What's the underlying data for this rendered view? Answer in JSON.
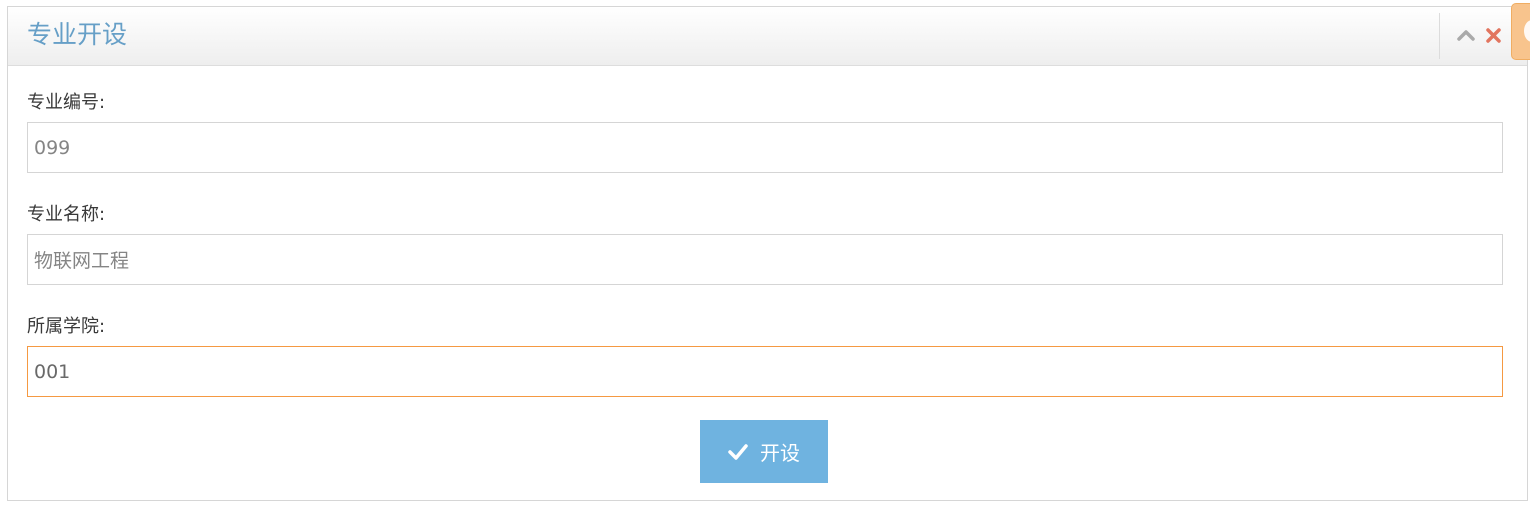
{
  "panel": {
    "title": "专业开设",
    "collapse_icon": "chevron-up-icon",
    "close_icon": "close-icon",
    "settings_icon": "gear-icon"
  },
  "form": {
    "major_code": {
      "label": "专业编号:",
      "value": "099"
    },
    "major_name": {
      "label": "专业名称:",
      "value": "物联网工程"
    },
    "college": {
      "label": "所属学院:",
      "value": "001"
    },
    "submit": {
      "label": "开设",
      "icon": "check-icon"
    }
  },
  "colors": {
    "title": "#669fc7",
    "focus_border": "#f59942",
    "button_bg": "#6fb3e0",
    "close_icon": "#e2755f"
  }
}
